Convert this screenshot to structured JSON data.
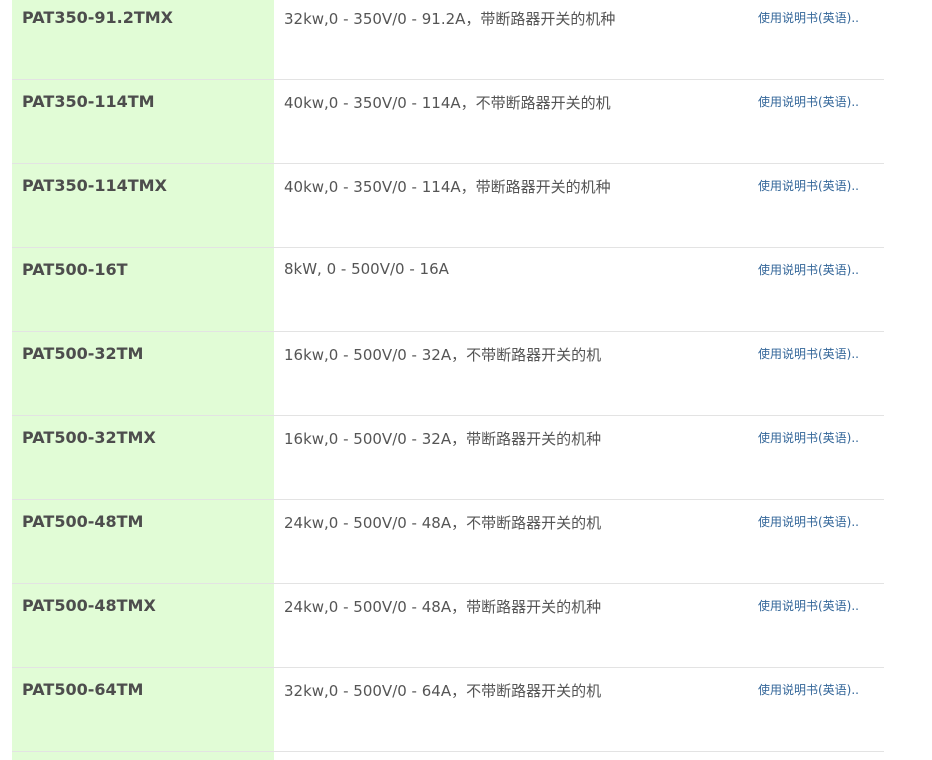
{
  "products": [
    {
      "model": "PAT350-91.2TMX",
      "desc": "32kw,0 - 350V/0 - 91.2A，带断路器开关的机种",
      "manual": "使用说明书(英语).."
    },
    {
      "model": "PAT350-114TM",
      "desc": "40kw,0 - 350V/0 - 114A，不带断路器开关的机",
      "manual": "使用说明书(英语).."
    },
    {
      "model": "PAT350-114TMX",
      "desc": "40kw,0 - 350V/0 - 114A，带断路器开关的机种",
      "manual": "使用说明书(英语).."
    },
    {
      "model": "PAT500-16T",
      "desc": "8kW, 0 - 500V/0 - 16A",
      "manual": "使用说明书(英语).."
    },
    {
      "model": "PAT500-32TM",
      "desc": "16kw,0 - 500V/0 - 32A，不带断路器开关的机",
      "manual": "使用说明书(英语).."
    },
    {
      "model": "PAT500-32TMX",
      "desc": "16kw,0 - 500V/0 - 32A，带断路器开关的机种",
      "manual": "使用说明书(英语).."
    },
    {
      "model": "PAT500-48TM",
      "desc": "24kw,0 - 500V/0 - 48A，不带断路器开关的机",
      "manual": "使用说明书(英语).."
    },
    {
      "model": "PAT500-48TMX",
      "desc": "24kw,0 - 500V/0 - 48A，带断路器开关的机种",
      "manual": "使用说明书(英语).."
    },
    {
      "model": "PAT500-64TM",
      "desc": "32kw,0 - 500V/0 - 64A，不带断路器开关的机",
      "manual": "使用说明书(英语).."
    }
  ],
  "colors": {
    "model_column_bg": "#e1fcd6",
    "link": "#336699",
    "text": "#555555"
  }
}
